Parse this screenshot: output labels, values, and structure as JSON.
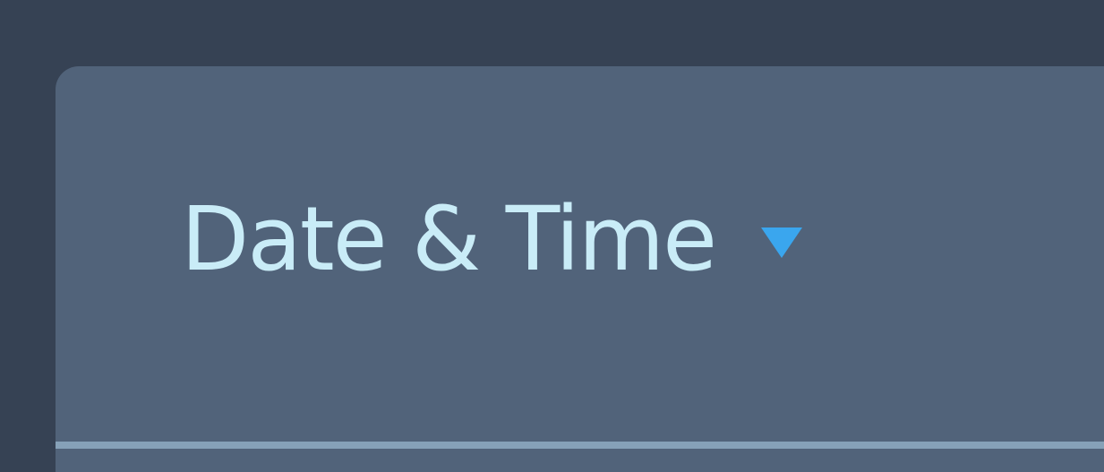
{
  "header": {
    "label": "Date & Time",
    "caret_icon": "caret-down-icon"
  },
  "colors": {
    "window_background": "#364254",
    "panel_background": "#51637a",
    "label_text": "#c9ecf7",
    "caret": "#3aa6ee",
    "divider": "#86a1b8"
  }
}
